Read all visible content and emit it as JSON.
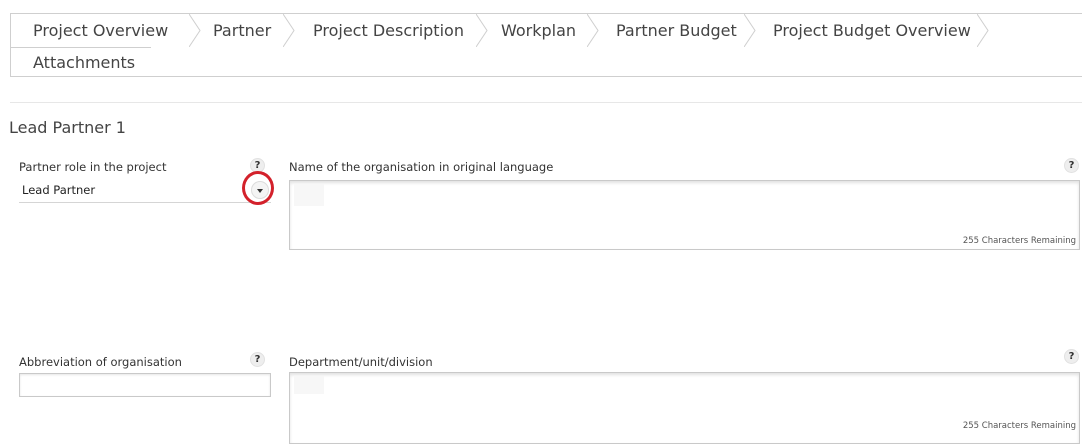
{
  "tabs": [
    {
      "label": "Project Overview",
      "active": true
    },
    {
      "label": "Partner"
    },
    {
      "label": "Project Description"
    },
    {
      "label": "Workplan"
    },
    {
      "label": "Partner Budget"
    },
    {
      "label": "Project Budget Overview"
    },
    {
      "label": "Attachments"
    }
  ],
  "section": {
    "title": "Lead Partner 1"
  },
  "fields": {
    "partner_role": {
      "label": "Partner role in the project",
      "value": "Lead Partner",
      "help": "?"
    },
    "org_name": {
      "label": "Name of the organisation in original language",
      "help": "?",
      "remaining": "255 Characters Remaining"
    },
    "abbreviation": {
      "label": "Abbreviation of organisation",
      "help": "?",
      "value": ""
    },
    "department": {
      "label": "Department/unit/division",
      "help": "?",
      "remaining": "255 Characters Remaining"
    }
  },
  "colors": {
    "annotation": "#d3212b",
    "border": "#cfcfcf"
  }
}
